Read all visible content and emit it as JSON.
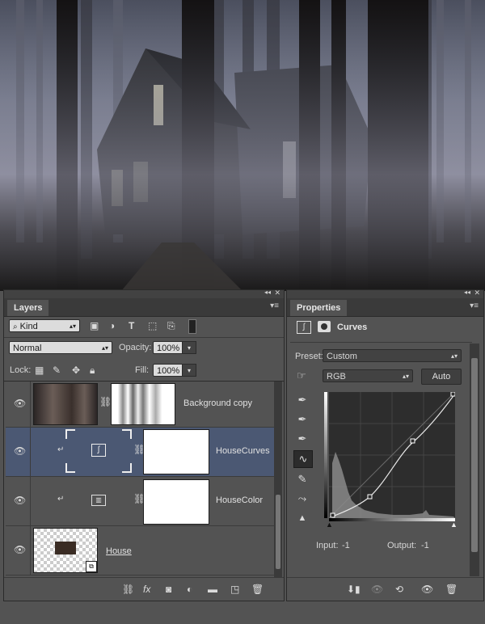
{
  "layers_panel": {
    "tab": "Layers",
    "filter_kind": "Kind",
    "blend_mode": "Normal",
    "opacity_label": "Opacity:",
    "opacity_value": "100%",
    "lock_label": "Lock:",
    "fill_label": "Fill:",
    "fill_value": "100%",
    "layers": [
      {
        "name": "Background copy"
      },
      {
        "name": "HouseCurves"
      },
      {
        "name": "HouseColor"
      },
      {
        "name": "House"
      }
    ]
  },
  "properties_panel": {
    "tab": "Properties",
    "title": "Curves",
    "preset_label": "Preset:",
    "preset_value": "Custom",
    "channel_value": "RGB",
    "auto_label": "Auto",
    "input_label": "Input:",
    "input_value": "-1",
    "output_label": "Output:",
    "output_value": "-1"
  },
  "colors": {
    "panel_bg": "#535353",
    "selected_row": "#4b5873",
    "dark": "#2b2b2b"
  }
}
